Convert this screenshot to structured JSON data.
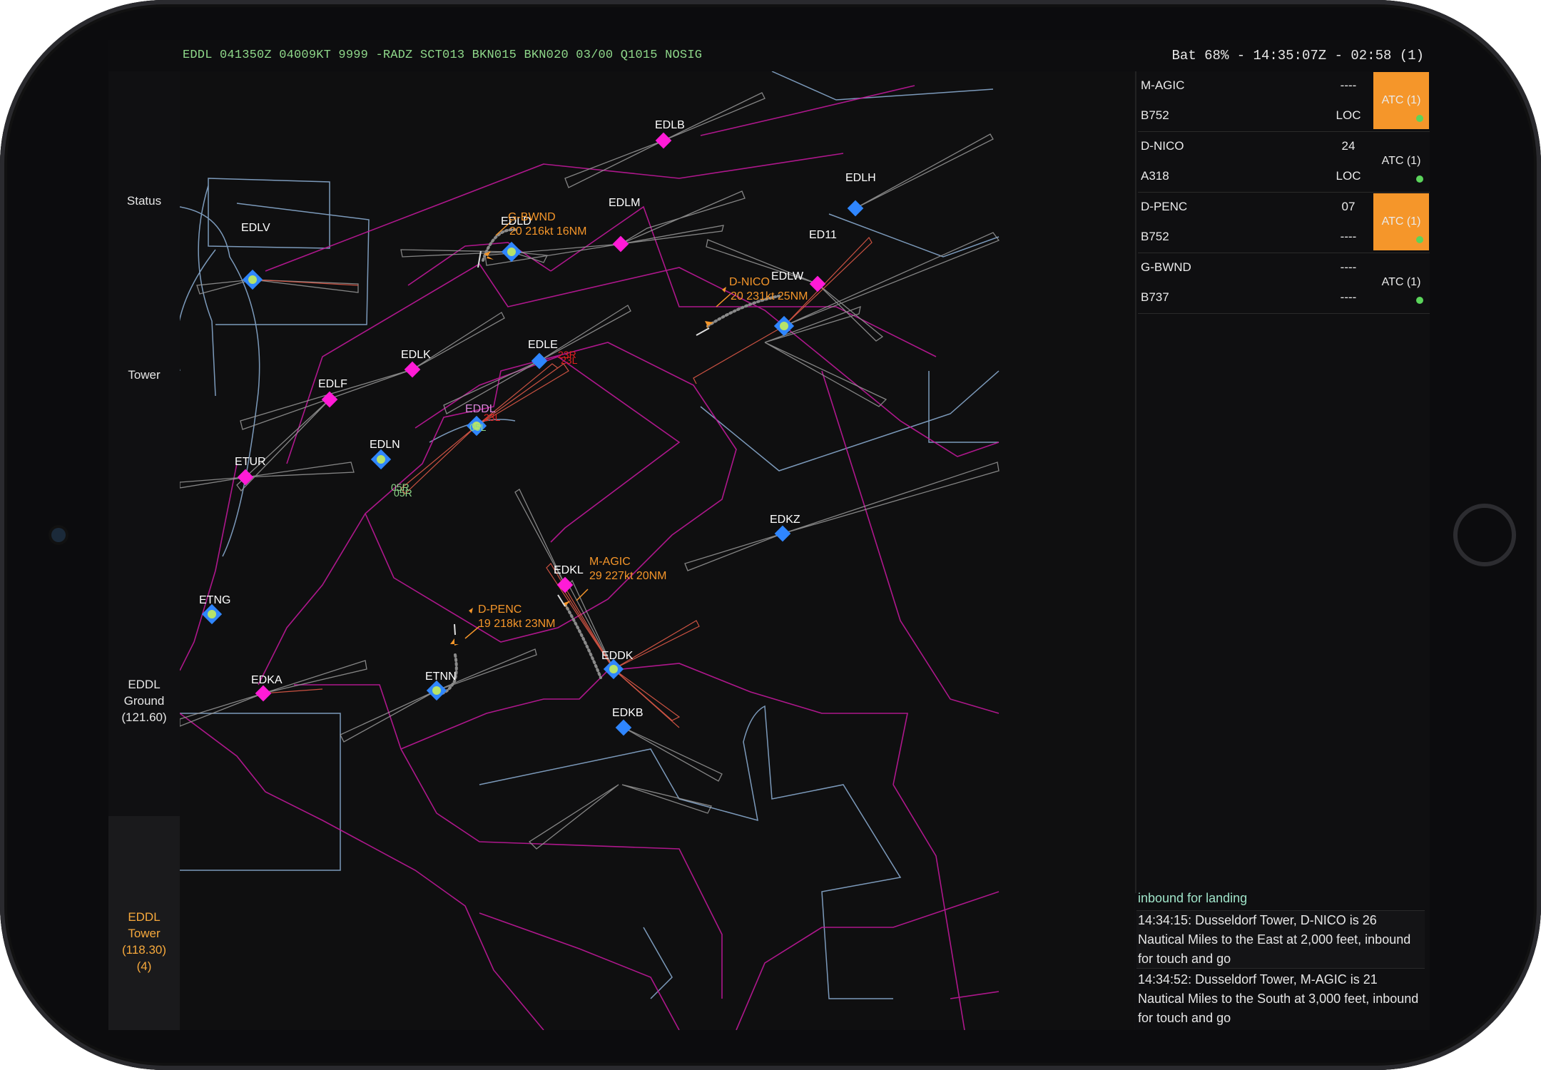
{
  "status_bar": {
    "metar": "EDDL 041350Z 04009KT 9999 -RADZ SCT013 BKN015 BKN020 03/00 Q1015 NOSIG",
    "battery_time": "Bat 68% - 14:35:07Z - 02:58 (1)"
  },
  "nav": {
    "status": "Status",
    "tower": "Tower",
    "ground": "EDDL\nGround\n(121.60)",
    "tower_freq": "EDDL\nTower\n(118.30)\n(4)"
  },
  "map": {
    "airports": [
      {
        "id": "EDLB",
        "label": "EDLB",
        "kind": "magenta"
      },
      {
        "id": "EDLH",
        "label": "EDLH",
        "kind": "blue"
      },
      {
        "id": "EDLM",
        "label": "EDLM",
        "kind": "magenta"
      },
      {
        "id": "EDLV",
        "label": "EDLV",
        "kind": "green"
      },
      {
        "id": "EDLD",
        "label": "EDLD",
        "kind": "green"
      },
      {
        "id": "ED11",
        "label": "ED11",
        "kind": "magenta"
      },
      {
        "id": "EDLW",
        "label": "EDLW",
        "kind": "green"
      },
      {
        "id": "EDLK",
        "label": "EDLK",
        "kind": "magenta"
      },
      {
        "id": "EDLE",
        "label": "EDLE",
        "kind": "blue"
      },
      {
        "id": "EDLF",
        "label": "EDLF",
        "kind": "magenta"
      },
      {
        "id": "EDDL",
        "label": "EDDL",
        "kind": "green"
      },
      {
        "id": "EDLN",
        "label": "EDLN",
        "kind": "green"
      },
      {
        "id": "ETUR",
        "label": "ETUR",
        "kind": "magenta"
      },
      {
        "id": "EDKZ",
        "label": "EDKZ",
        "kind": "blue"
      },
      {
        "id": "EDKL",
        "label": "EDKL",
        "kind": "magenta"
      },
      {
        "id": "ETNG",
        "label": "ETNG",
        "kind": "green"
      },
      {
        "id": "EDDK",
        "label": "EDDK",
        "kind": "green"
      },
      {
        "id": "EDKA",
        "label": "EDKA",
        "kind": "magenta"
      },
      {
        "id": "ETNN",
        "label": "ETNN",
        "kind": "green"
      },
      {
        "id": "EDKB",
        "label": "EDKB",
        "kind": "blue"
      }
    ],
    "aircraft": [
      {
        "callsign": "G-BWND",
        "info": "20 216kt 16NM"
      },
      {
        "callsign": "D-NICO",
        "info": "20 231kt 25NM"
      },
      {
        "callsign": "M-AGIC",
        "info": "29 227kt 20NM"
      },
      {
        "callsign": "D-PENC",
        "info": "19 218kt 23NM"
      }
    ],
    "runway_labels": [
      "23R",
      "23L",
      "05L",
      "05R",
      "23L",
      "05R"
    ]
  },
  "strips": [
    {
      "callsign": "M-AGIC",
      "type": "B752",
      "v1": "----",
      "v2": "LOC",
      "atc": "ATC (1)",
      "highlight": true
    },
    {
      "callsign": "D-NICO",
      "type": "A318",
      "v1": "24",
      "v2": "LOC",
      "atc": "ATC (1)",
      "highlight": false
    },
    {
      "callsign": "D-PENC",
      "type": "B752",
      "v1": "07",
      "v2": "----",
      "atc": "ATC (1)",
      "highlight": true
    },
    {
      "callsign": "G-BWND",
      "type": "B737",
      "v1": "----",
      "v2": "----",
      "atc": "ATC (1)",
      "highlight": false
    }
  ],
  "messages": [
    "inbound for landing",
    "14:34:15: Dusseldorf Tower, D-NICO is 26 Nautical Miles to the East at 2,000 feet, inbound for touch and go",
    "14:34:52: Dusseldorf Tower, M-AGIC is 21 Nautical Miles to the South at 3,000 feet, inbound for touch and go"
  ],
  "colors": {
    "accent_orange": "#f5962a",
    "airspace_magenta": "#c0189a",
    "border_blue": "#8fb3d9",
    "metar_green": "#8fd88a",
    "airport_magenta": "#ff1bd6",
    "airport_blue": "#2f86ff"
  }
}
